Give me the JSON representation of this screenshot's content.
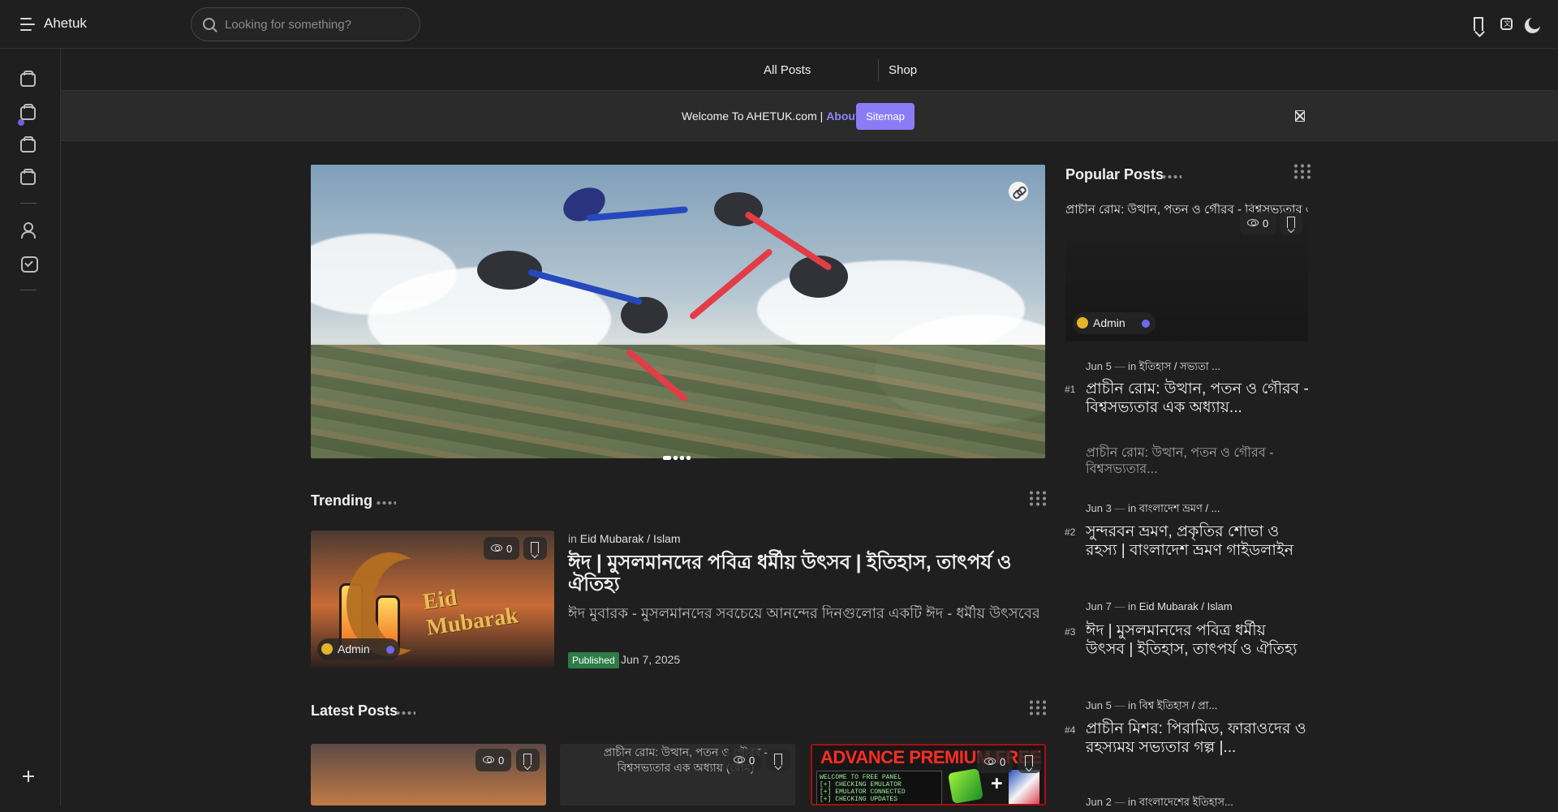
{
  "header": {
    "brand": "Ahetuk",
    "search_placeholder": "Looking for something?",
    "icons": [
      "menu-icon",
      "search-icon",
      "bookmark-icon",
      "translate-icon",
      "moon-icon"
    ]
  },
  "sidebar": {
    "items": [
      {
        "icon": "folder-icon"
      },
      {
        "icon": "folder-icon"
      },
      {
        "icon": "folder-icon"
      },
      {
        "icon": "folder-icon"
      },
      {
        "icon": "user-group-icon"
      },
      {
        "icon": "profile-check-icon"
      }
    ],
    "add_icon": "plus-icon"
  },
  "subnav": {
    "all_posts": "All Posts",
    "shop": "Shop"
  },
  "announcement": {
    "welcome": "Welcome To AHETUK.com |",
    "about": "About",
    "sitemap": "Sitemap"
  },
  "hero": {
    "active_slide": 1,
    "slide_count": 4
  },
  "trending": {
    "title": "Trending",
    "post": {
      "views": "0",
      "author": "Admin",
      "category_prefix": "in",
      "category": "Eid Mubarak / Islam",
      "title": "ঈদ | মুসলমানদের পবিত্র ধর্মীয় উৎসব | ইতিহাস, তাৎপর্য ও ঐতিহ্য",
      "snippet": "ঈদ মুবারক - মুসলমানদের সবচেয়ে আনন্দের দিনগুলোর একটি ঈদ - ধর্মীয় উৎসবের এক অনন্য মুহূর্ত যেখানে আনন্দ, ঐক্য...",
      "status": "Published",
      "date": "Jun 7, 2025",
      "image_text": "Eid Mubarak"
    }
  },
  "latest": {
    "title": "Latest Posts",
    "cards": [
      {
        "views": "0"
      },
      {
        "views": "0",
        "alt": "প্রাচীন রোম: উত্থান, পতন ও গৌরব - বিশ্বসভ্যতার এক অধ্যায় (রোম)"
      },
      {
        "views": "0",
        "ad_title": "ADVANCE PREMIUM FREE PANEL",
        "terminal_lines": [
          "WELCOME TO FREE PANEL",
          "[+] CHECKING EMULATOR",
          "[+] EMULATOR CONNECTED",
          "[+] CHECKING UPDATES"
        ]
      }
    ]
  },
  "popular": {
    "title": "Popular Posts",
    "featured": {
      "views": "0",
      "author": "Admin",
      "alt": "প্রাচীন রোম: উত্থান, পতন ও গৌরব - বিশ্বসভ্যতার এক অধ্যায় (রোম)"
    },
    "items": [
      {
        "rank": "#1",
        "date": "Jun 5",
        "category": "ইতিহাস / সভ্যতা ...",
        "title": "প্রাচীন রোম: উত্থান, পতন ও গৌরব - বিশ্বসভ্যতার এক অধ্যায়...",
        "snippet": "প্রাচীন রোম: উত্থান, পতন ও গৌরব - বিশ্বসভ্যতার..."
      },
      {
        "rank": "#2",
        "date": "Jun 3",
        "category": "বাংলাদেশ ভ্রমণ / ...",
        "title": "সুন্দরবন ভ্রমণ, প্রকৃতির শোভা ও রহস্য | বাংলাদেশ ভ্রমণ গাইডলাইন"
      },
      {
        "rank": "#3",
        "date": "Jun 7",
        "category": "Eid Mubarak / Islam",
        "title": "ঈদ | মুসলমানদের পবিত্র ধর্মীয় উৎসব | ইতিহাস, তাৎপর্য ও ঐতিহ্য"
      },
      {
        "rank": "#4",
        "date": "Jun 5",
        "category": "বিশ্ব ইতিহাস / প্রা...",
        "title": "প্রাচীন মিশর: পিরামিড, ফারাওদের ও রহস্যময় সভ্যতার গল্প |..."
      },
      {
        "date": "Jun 2",
        "category": "বাংলাদেশের ইতিহাস..."
      }
    ]
  },
  "colors": {
    "background": "#1f1f1f",
    "accent": "#8b7cf6",
    "published": "#2d7c47",
    "border": "#353535"
  }
}
